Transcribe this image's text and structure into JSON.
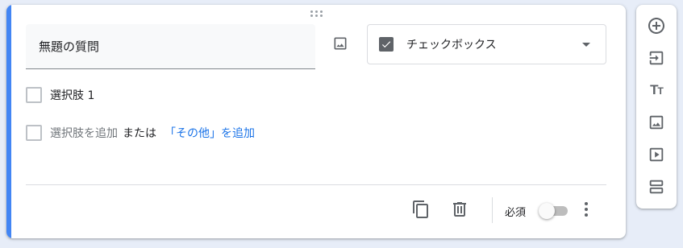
{
  "question": {
    "title": "無題の質問",
    "type_label": "チェックボックス",
    "options": [
      {
        "label": "選択肢 1"
      }
    ],
    "add_option_label": "選択肢を追加",
    "or_label": "または",
    "add_other_label": "「その他」を追加"
  },
  "footer": {
    "required_label": "必須",
    "required": false
  },
  "colors": {
    "accent": "#4285f4",
    "link": "#1a73e8",
    "icon": "#5f6368"
  },
  "toolbar_icons": [
    "add-question-icon",
    "import-questions-icon",
    "add-title-icon",
    "add-image-icon",
    "add-video-icon",
    "add-section-icon"
  ]
}
